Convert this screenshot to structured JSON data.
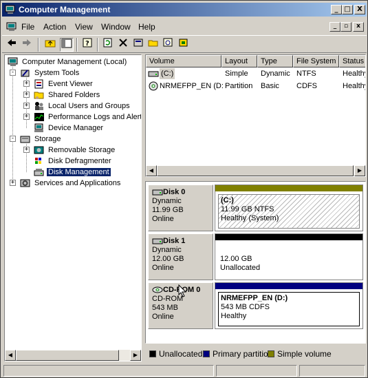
{
  "window": {
    "title": "Computer Management",
    "buttons": [
      "_",
      "□",
      "X"
    ]
  },
  "menubar": {
    "items": [
      {
        "label": "File"
      },
      {
        "label": "Action"
      },
      {
        "label": "View"
      },
      {
        "label": "Window"
      },
      {
        "label": "Help"
      }
    ],
    "mdi_buttons": [
      "_",
      "▫",
      "x"
    ]
  },
  "toolbar": {
    "icons": [
      "back-arrow-icon",
      "forward-arrow-icon",
      "up-folder-icon",
      "show-hide-tree-icon",
      "help-icon",
      "refresh-icon",
      "delete-icon",
      "properties-icon",
      "open-icon",
      "find-icon",
      "wizard-icon"
    ]
  },
  "tree": {
    "items": [
      {
        "label": "Computer Management (Local)",
        "icon": "computer-icon"
      },
      {
        "label": "System Tools",
        "icon": "tools-icon"
      },
      {
        "label": "Event Viewer",
        "icon": "event-viewer-icon"
      },
      {
        "label": "Shared Folders",
        "icon": "shared-folder-icon"
      },
      {
        "label": "Local Users and Groups",
        "icon": "users-icon"
      },
      {
        "label": "Performance Logs and Alerts",
        "icon": "performance-icon"
      },
      {
        "label": "Device Manager",
        "icon": "device-manager-icon"
      },
      {
        "label": "Storage",
        "icon": "storage-icon"
      },
      {
        "label": "Removable Storage",
        "icon": "removable-storage-icon"
      },
      {
        "label": "Disk Defragmenter",
        "icon": "defrag-icon"
      },
      {
        "label": "Disk Management",
        "icon": "disk-management-icon",
        "selected": true
      },
      {
        "label": "Services and Applications",
        "icon": "services-icon"
      }
    ]
  },
  "volume_list": {
    "columns": [
      "Volume",
      "Layout",
      "Type",
      "File System",
      "Status"
    ],
    "rows": [
      {
        "volume": "(C:)",
        "layout": "Simple",
        "type": "Dynamic",
        "file_system": "NTFS",
        "status": "Healthy"
      },
      {
        "volume": "NRMEFPP_EN (D:)",
        "layout": "Partition",
        "type": "Basic",
        "file_system": "CDFS",
        "status": "Healthy"
      }
    ]
  },
  "disks": [
    {
      "name": "Disk 0",
      "type": "Dynamic",
      "size": "11.99 GB",
      "state": "Online",
      "partition": {
        "title": "(C:)",
        "line1": "11.99 GB NTFS",
        "line2": "Healthy (System)",
        "band_color": "#808000"
      }
    },
    {
      "name": "Disk 1",
      "type": "Dynamic",
      "size": "12.00 GB",
      "state": "Online",
      "partition": {
        "title": "",
        "line1": "12.00 GB",
        "line2": "Unallocated",
        "band_color": "#000000"
      }
    },
    {
      "name": "CD-ROM 0",
      "type": "CD-ROM",
      "size": "543 MB",
      "state": "Online",
      "partition": {
        "title": "NRMEFPP_EN  (D:)",
        "line1": "543 MB CDFS",
        "line2": "Healthy",
        "band_color": "#000080"
      }
    }
  ],
  "legend": [
    {
      "label": "Unallocated",
      "color": "#000000"
    },
    {
      "label": "Primary partition",
      "color": "#000080"
    },
    {
      "label": "Simple volume",
      "color": "#808000"
    }
  ],
  "colors": {
    "titlebar_start": "#0a246a",
    "titlebar_end": "#a6caf0",
    "selection": "#0a246a"
  }
}
